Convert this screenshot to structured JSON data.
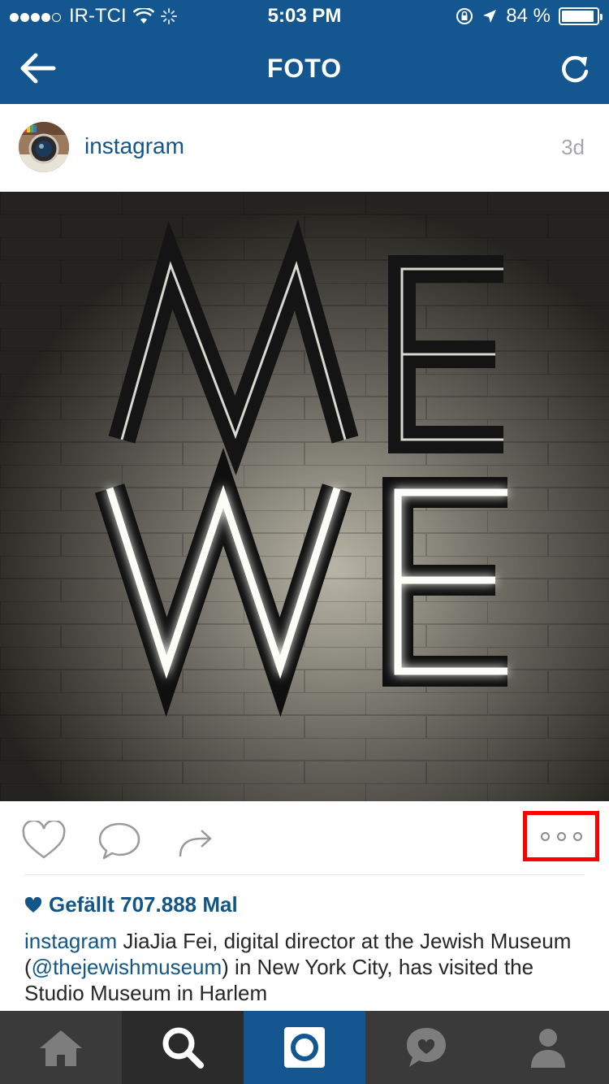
{
  "status_bar": {
    "carrier": "IR-TCI",
    "time": "5:03 PM",
    "battery": "84 %",
    "battery_level": 0.84,
    "signal_bars": 4
  },
  "nav": {
    "title": "FOTO",
    "back_icon": "back-arrow-icon",
    "refresh_icon": "refresh-icon"
  },
  "post": {
    "username": "instagram",
    "age": "3d",
    "image_alt": "neon sign reading ME WE",
    "likes": "Gefällt 707.888 Mal",
    "caption_user": "instagram",
    "caption_before_mention": " JiaJia Fei, digital director at the Jewish Museum (",
    "caption_mention": "@thejewishmuseum",
    "caption_after_mention": ") in New York City, has visited the Studio Museum in Harlem"
  },
  "tabs": [
    {
      "name": "home",
      "icon": "home-icon"
    },
    {
      "name": "search",
      "icon": "search-icon"
    },
    {
      "name": "camera",
      "icon": "camera-icon"
    },
    {
      "name": "activity",
      "icon": "heart-bubble-icon"
    },
    {
      "name": "profile",
      "icon": "profile-icon"
    }
  ],
  "colors": {
    "brand_blue": "#135690",
    "link_blue": "#125688",
    "highlight": "#ff0000"
  }
}
